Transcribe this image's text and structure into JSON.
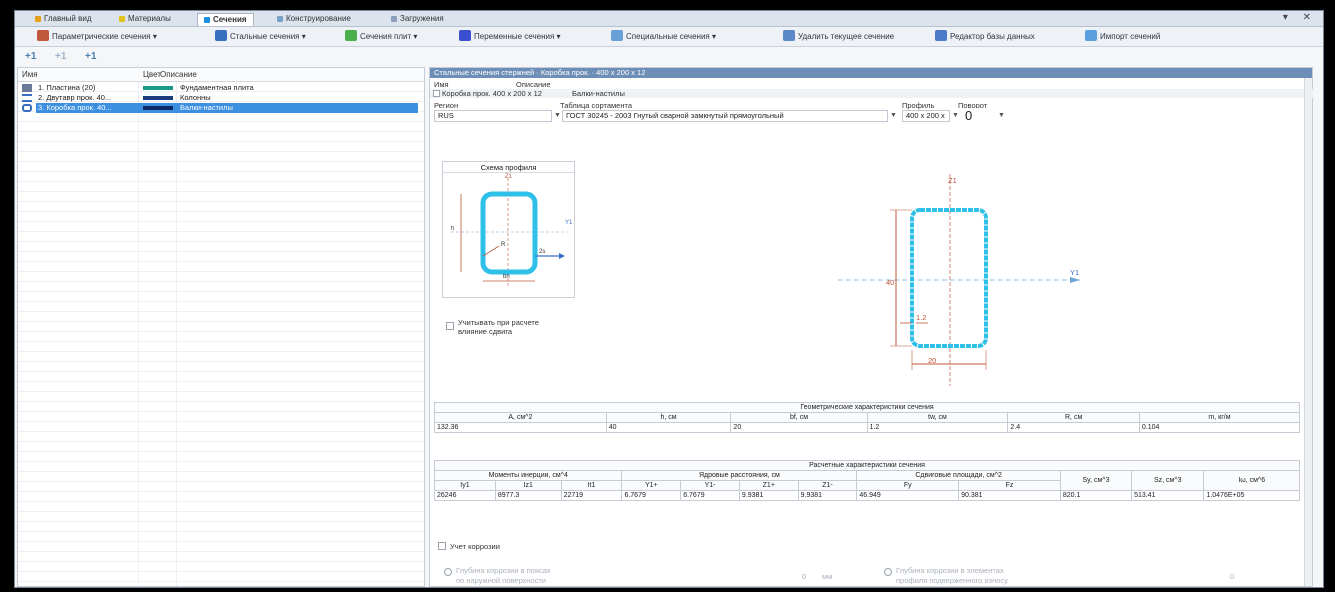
{
  "tabs": [
    {
      "label": "Главный вид",
      "color": "#e3a21a"
    },
    {
      "label": "Материалы",
      "color": "#e3c21a"
    },
    {
      "label": "Сечения",
      "color": "#1a8fe3",
      "active": true
    },
    {
      "label": "Конструирование",
      "color": "#7aa0c8"
    },
    {
      "label": "Загружения",
      "color": "#8aa0b8"
    }
  ],
  "window_controls": "▾ ✕",
  "toolbar": [
    {
      "label": "Параметрические сечения ▾",
      "icon": "parametric-section-icon",
      "color": "#c0563a"
    },
    {
      "label": "Стальные сечения ▾",
      "icon": "steel-section-icon",
      "color": "#3a6fc0"
    },
    {
      "label": "Сечения плит ▾",
      "icon": "plate-section-icon",
      "color": "#4bb04b"
    },
    {
      "label": "Переменные сечения ▾",
      "icon": "variable-section-icon",
      "color": "#3a4fd0"
    },
    {
      "label": "Специальные сечения ▾",
      "icon": "special-section-icon",
      "color": "#6aa0d8"
    },
    {
      "label": "Удалить текущее сечение",
      "icon": "delete-section-icon",
      "color": "#5a88c8"
    },
    {
      "label": "Редактор базы данных",
      "icon": "database-editor-icon",
      "color": "#4a7ac8"
    },
    {
      "label": "Импорт сечений",
      "icon": "import-sections-icon",
      "color": "#5aa0e0"
    }
  ],
  "subtoolbar": [
    "+1",
    "+1",
    "+1"
  ],
  "list": {
    "headers": {
      "name": "Имя",
      "color": "Цвет",
      "description": "Описание"
    },
    "rows": [
      {
        "name": "1. Пластина (20)",
        "color": "#1a9a8a",
        "description": "Фундаментная плита",
        "selected": false
      },
      {
        "name": "2. Двутавр прок. 40...",
        "color": "#1a3a7a",
        "description": "Колонны",
        "selected": false
      },
      {
        "name": "3. Коробка прок. 40...",
        "color": "#0a2a6a",
        "description": "Балки-настилы",
        "selected": true
      }
    ]
  },
  "detail": {
    "title": "Стальные сечения стержней · Коробка прок. · 400 x 200 x 12",
    "name_label": "Имя",
    "desc_label": "Описание",
    "name_value": "Коробка прок. 400 x 200 x 12",
    "desc_value": "Балки-настилы",
    "region_label": "Регион",
    "region_value": "RUS",
    "table_label": "Таблица сортамента",
    "table_value": "ГОСТ 30245 - 2003 Гнутый сварной замкнутый прямоугольный",
    "profile_label": "Профиль",
    "profile_value": "400 x 200 x",
    "rotation_label": "Поворот",
    "rotation_value": "0",
    "scheme_title": "Схема профиля",
    "shear_label_1": "Учитывать при расчете",
    "shear_label_2": "влияние сдвига",
    "dim_h": "40",
    "dim_b": "20",
    "dim_t": "1.2",
    "axis_z": "Z1",
    "axis_y": "Y1",
    "scheme_r": "R",
    "scheme_t": "2s",
    "scheme_b": "bn",
    "scheme_h": "h"
  },
  "geom": {
    "title": "Геометрические характеристики сечения",
    "headers": [
      "A, см^2",
      "h, см",
      "bf, см",
      "tw, см",
      "R, см",
      "m, кг/м"
    ],
    "values": [
      "132.36",
      "40",
      "20",
      "1.2",
      "2.4",
      "0.104"
    ]
  },
  "calc": {
    "title": "Расчетные характеристики сечения",
    "group1": "Моменты инерции, см^4",
    "group2": "Ядровые расстояния, см",
    "group3": "Сдвиговые площади, см^2",
    "sub": [
      "Iy1",
      "Iz1",
      "It1",
      "Y1+",
      "Y1-",
      "Z1+",
      "Z1-",
      "Fy",
      "Fz",
      "Sy, см^3",
      "Sz, см^3",
      "Iω, см^6"
    ],
    "values": [
      "26246",
      "8977.3",
      "22719",
      "6.7679",
      "6.7679",
      "9.9381",
      "9.9381",
      "46.949",
      "90.381",
      "820.1",
      "513.41",
      "1.0476E+05"
    ]
  },
  "armature": {
    "label": "Учет коррозии",
    "opt1_1": "Глубина коррозии в поясах",
    "opt1_2": "по наружной поверхности",
    "opt2_1": "Глубина коррозии в элементах",
    "opt2_2": "профиля подверженного износу",
    "val1": "0",
    "val1_unit": "мм",
    "val2": "0"
  }
}
